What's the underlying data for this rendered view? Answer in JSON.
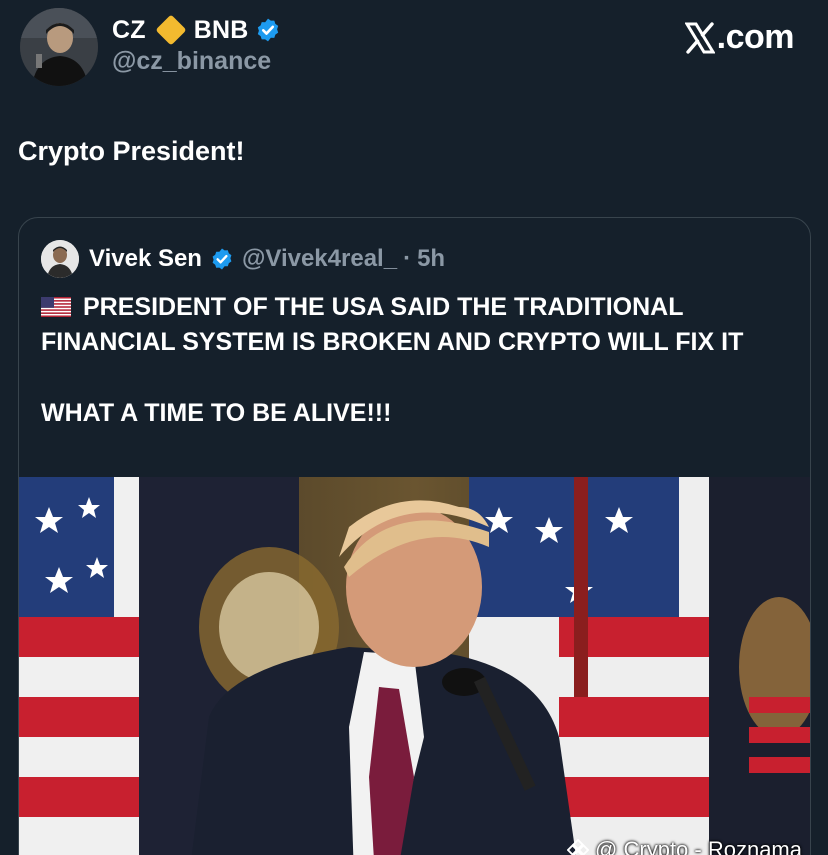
{
  "header": {
    "name_first": "CZ",
    "name_second": "BNB",
    "handle": "@cz_binance",
    "site_label": ".com"
  },
  "tweet": {
    "text": "Crypto President!"
  },
  "quoted": {
    "name": "Vivek Sen",
    "handle": "@Vivek4real_",
    "separator": "·",
    "time": "5h",
    "line1": "PRESIDENT OF THE USA SAID THE TRADITIONAL FINANCIAL SYSTEM IS BROKEN AND CRYPTO WILL FIX IT",
    "line2": "WHAT A TIME TO BE ALIVE!!!"
  },
  "media": {
    "watermark": "@ Crypto - Roznama"
  },
  "colors": {
    "background": "#15202b",
    "verified": "#1d9bf0",
    "secondary_text": "#8b98a5",
    "border": "#38444d",
    "bnb": "#f3ba2f"
  },
  "icons": [
    "bnb-diamond-icon",
    "verified-badge-icon",
    "x-logo-icon",
    "us-flag-icon",
    "binance-logo-icon"
  ]
}
